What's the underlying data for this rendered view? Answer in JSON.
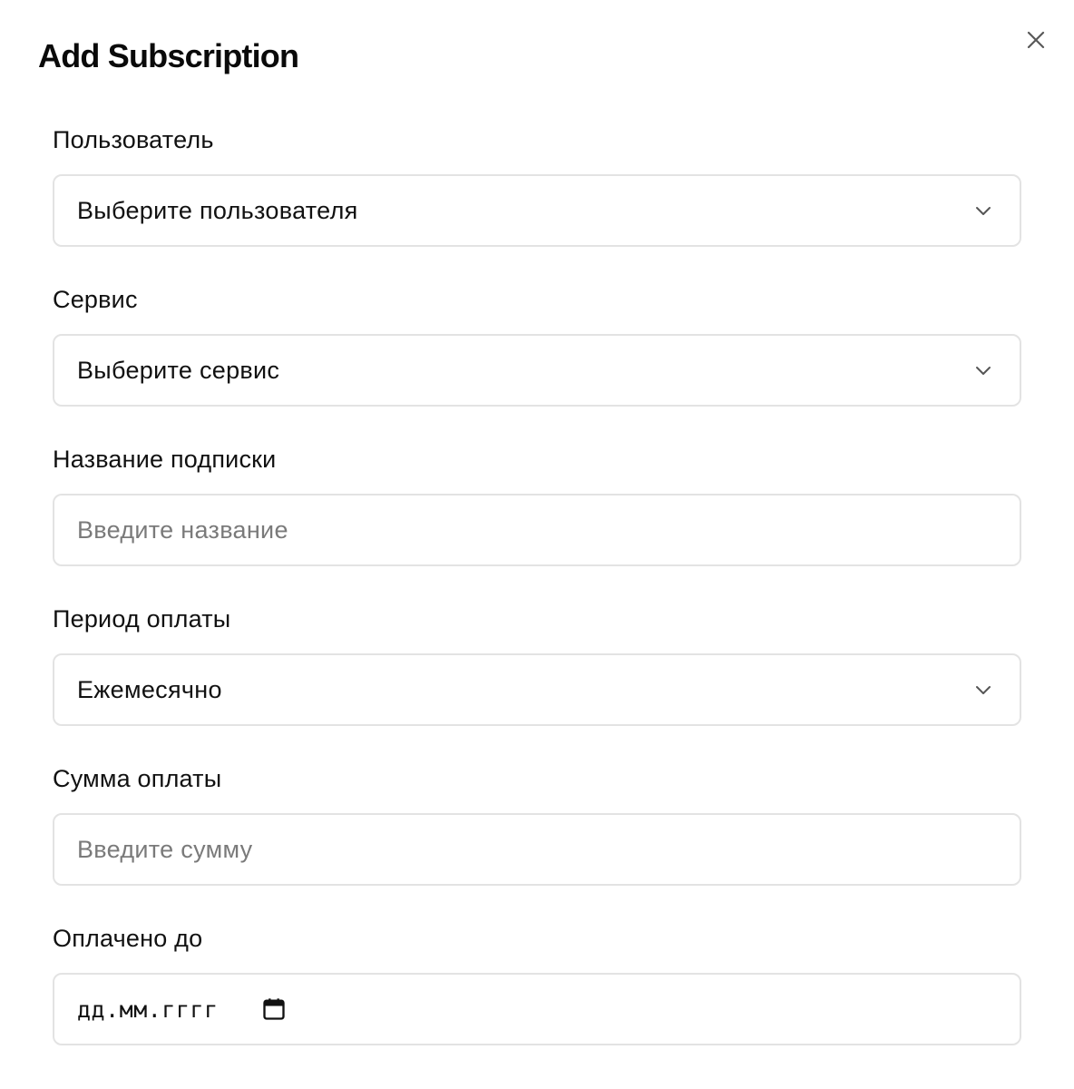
{
  "modal": {
    "title": "Add Subscription",
    "close_icon": "close-icon"
  },
  "form": {
    "user": {
      "label": "Пользователь",
      "value": "Выберите пользователя",
      "icon": "chevron-down-icon"
    },
    "service": {
      "label": "Сервис",
      "value": "Выберите сервис",
      "icon": "chevron-down-icon"
    },
    "subscription_name": {
      "label": "Название подписки",
      "placeholder": "Введите название",
      "value": ""
    },
    "billing_period": {
      "label": "Период оплаты",
      "value": "Ежемесячно",
      "icon": "chevron-down-icon"
    },
    "amount": {
      "label": "Сумма оплаты",
      "placeholder": "Введите сумму",
      "value": ""
    },
    "paid_until": {
      "label": "Оплачено до",
      "placeholder": "дд.мм.гггг",
      "icon": "calendar-icon"
    }
  },
  "colors": {
    "border": "#e3e3e3",
    "text": "#111111",
    "placeholder": "#7a7a7a",
    "background": "#ffffff"
  }
}
